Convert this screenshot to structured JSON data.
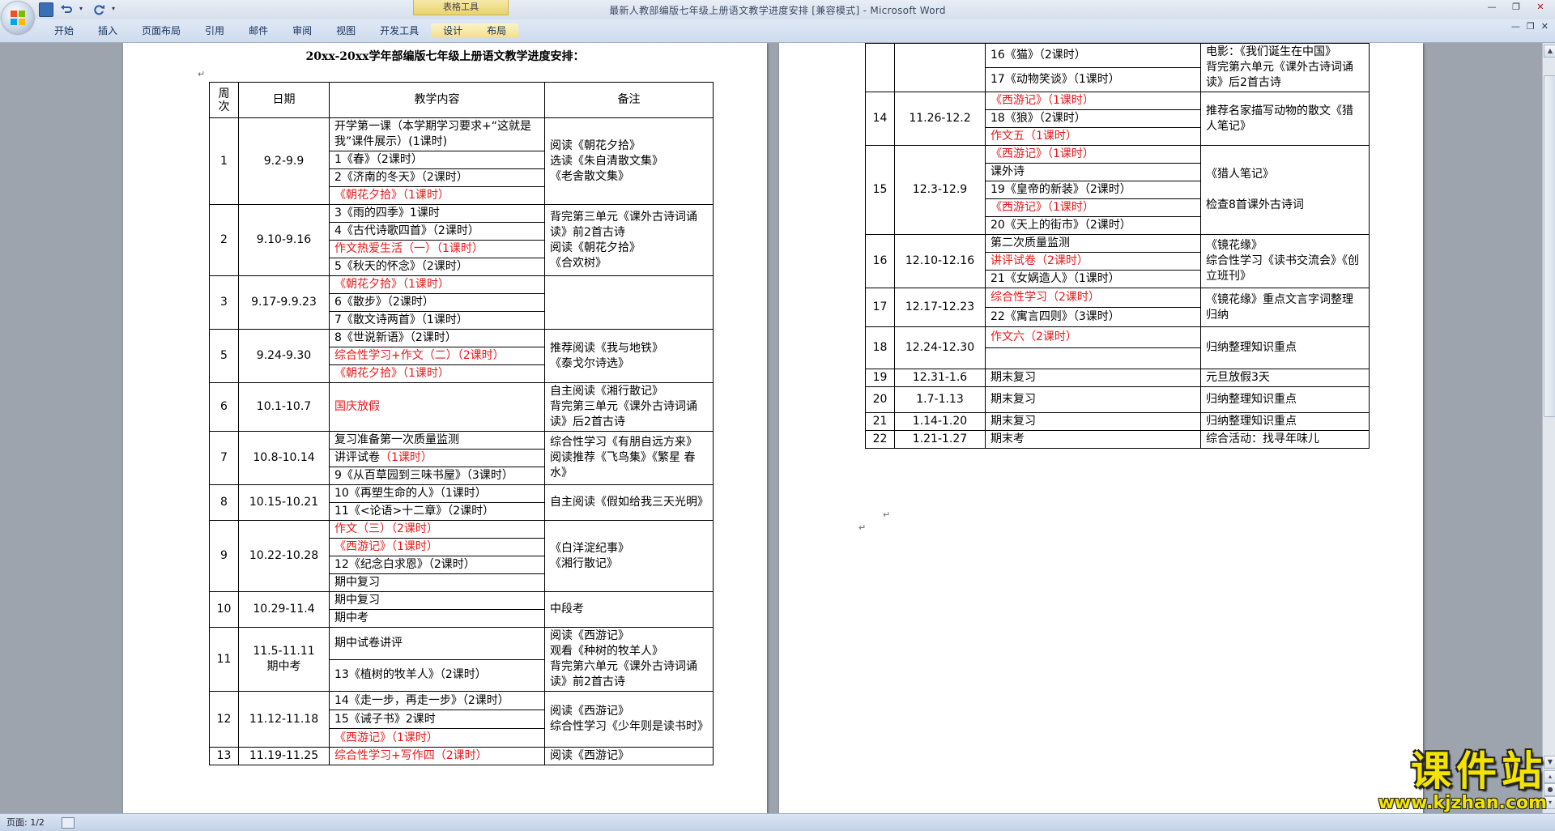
{
  "window": {
    "title": "最新人教部编版七年级上册语文教学进度安排 [兼容模式] - Microsoft Word",
    "context_tab_group": "表格工具"
  },
  "ribbon_tabs": [
    "开始",
    "插入",
    "页面布局",
    "引用",
    "邮件",
    "审阅",
    "视图",
    "开发工具",
    "设计",
    "布局"
  ],
  "status": {
    "page": "页面: 1/2"
  },
  "doc": {
    "title": "20xx-20xx学年部编版七年级上册语文教学进度安排：",
    "headers": {
      "week": "周次",
      "date": "日期",
      "content": "教学内容",
      "note": "备注"
    }
  },
  "rows_p1": [
    {
      "week": "1",
      "date": "9.2-9.9",
      "items": [
        {
          "t": "开学第一课（本学期学习要求+“这就是我”课件展示）(1课时)",
          "red": false
        },
        {
          "t": "1《春》（2课时）",
          "red": false
        },
        {
          "t": "2《济南的冬天》（2课时）",
          "red": false
        },
        {
          "t": "《朝花夕拾》（1课时）",
          "red": true
        }
      ],
      "note": "阅读《朝花夕拾》\n选读《朱自清散文集》\n《老舍散文集》"
    },
    {
      "week": "2",
      "date": "9.10-9.16",
      "items": [
        {
          "t": "3《雨的四季》1课时",
          "red": false
        },
        {
          "t": "4《古代诗歌四首》（2课时）",
          "red": false
        },
        {
          "t": "作文热爱生活（一）（1课时）",
          "red": true
        },
        {
          "t": "5《秋天的怀念》（2课时）",
          "red": false
        }
      ],
      "note": "背完第三单元《课外古诗词诵读》前2首古诗\n阅读《朝花夕拾》\n《合欢树》"
    },
    {
      "week": "3",
      "date": "9.17-9.9.23",
      "items": [
        {
          "t": "《朝花夕拾》（1课时）",
          "red": true
        },
        {
          "t": "6《散步》（2课时）",
          "red": false
        },
        {
          "t": "7《散文诗两首》（1课时）",
          "red": false
        }
      ],
      "note": ""
    },
    {
      "week": "5",
      "date": "9.24-9.30",
      "items": [
        {
          "t": "8《世说新语》（2课时）",
          "red": false
        },
        {
          "t": "综合性学习+作文（二）（2课时）",
          "red": true
        },
        {
          "t": "《朝花夕拾》（1课时）",
          "red": true
        }
      ],
      "note": "推荐阅读《我与地铁》\n《泰戈尔诗选》"
    },
    {
      "week": "6",
      "date": "10.1-10.7",
      "items": [
        {
          "t": "国庆放假",
          "red": true
        }
      ],
      "note": "自主阅读《湘行散记》\n背完第三单元《课外古诗词诵读》后2首古诗"
    },
    {
      "week": "7",
      "date": "10.8-10.14",
      "items": [
        {
          "t": "复习准备第一次质量监测",
          "red": false
        },
        {
          "t": "讲评试卷",
          "red": false,
          "suffix": "（1课时）"
        },
        {
          "t": "9《从百草园到三味书屋》（3课时）",
          "red": false
        }
      ],
      "note": "综合性学习《有朋自远方来》阅读推荐《飞鸟集》《繁星 春水》"
    },
    {
      "week": "8",
      "date": "10.15-10.21",
      "items": [
        {
          "t": "10《再塑生命的人》（1课时）",
          "red": false
        },
        {
          "t": "11《<论语>十二章》（2课时）",
          "red": false
        }
      ],
      "note": "自主阅读《假如给我三天光明》"
    },
    {
      "week": "9",
      "date": "10.22-10.28",
      "items": [
        {
          "t": "作文（三）（2课时）",
          "red": true
        },
        {
          "t": "《西游记》（1课时）",
          "red": true
        },
        {
          "t": "12《纪念白求恩》（2课时）",
          "red": false
        },
        {
          "t": "期中复习",
          "red": false
        }
      ],
      "note": "《白洋淀纪事》\n《湘行散记》"
    },
    {
      "week": "10",
      "date": "10.29-11.4",
      "items": [
        {
          "t": "期中复习",
          "red": false
        },
        {
          "t": "期中考",
          "red": false
        }
      ],
      "note": "中段考"
    },
    {
      "week": "11",
      "date": "11.5-11.11\n期中考",
      "items": [
        {
          "t": "期中试卷讲评",
          "red": false
        },
        {
          "t": "13《植树的牧羊人》（2课时）",
          "red": false
        }
      ],
      "note": "阅读《西游记》\n观看《种树的牧羊人》\n背完第六单元《课外古诗词诵读》前2首古诗"
    },
    {
      "week": "12",
      "date": "11.12-11.18",
      "items": [
        {
          "t": "14《走一步，再走一步》（2课时）",
          "red": false
        },
        {
          "t": "15《诫子书》2课时",
          "red": false
        },
        {
          "t": "《西游记》（1课时）",
          "red": true
        }
      ],
      "note": "阅读《西游记》\n综合性学习《少年则是读书时》"
    },
    {
      "week": "13",
      "date": "11.19-11.25",
      "items": [
        {
          "t": "综合性学习+写作四（2课时）",
          "red": true
        }
      ],
      "note": "阅读《西游记》"
    }
  ],
  "rows_p2": [
    {
      "week": "",
      "date": "",
      "items": [
        {
          "t": "16《猫》（2课时）",
          "red": false
        },
        {
          "t": "17《动物笑谈》（1课时）",
          "red": false
        }
      ],
      "note": "电影：《我们诞生在中国》\n背完第六单元《课外古诗词诵读》后2首古诗"
    },
    {
      "week": "14",
      "date": "11.26-12.2",
      "items": [
        {
          "t": "《西游记》（1课时）",
          "red": true
        },
        {
          "t": "18《狼》（2课时）",
          "red": false
        },
        {
          "t": "作文五（1课时）",
          "red": true
        }
      ],
      "note": "推荐名家描写动物的散文《猎人笔记》"
    },
    {
      "week": "15",
      "date": "12.3-12.9",
      "items": [
        {
          "t": "《西游记》（1课时）",
          "red": true
        },
        {
          "t": "课外诗",
          "red": false
        },
        {
          "t": "19《皇帝的新装》（2课时）",
          "red": false
        },
        {
          "t": "《西游记》（1课时）",
          "red": true
        },
        {
          "t": "20《天上的街市》（2课时）",
          "red": false
        }
      ],
      "note": "《猎人笔记》\n\n检查8首课外古诗词"
    },
    {
      "week": "16",
      "date": "12.10-12.16",
      "items": [
        {
          "t": "第二次质量监测",
          "red": false
        },
        {
          "t": "讲评试卷（2课时）",
          "red": true
        },
        {
          "t": "21《女娲造人》（1课时）",
          "red": false
        }
      ],
      "note": "《镜花缘》\n综合性学习《读书交流会》《创立班刊》"
    },
    {
      "week": "17",
      "date": "12.17-12.23",
      "items": [
        {
          "t": "综合性学习（2课时）",
          "red": true
        },
        {
          "t": "22《寓言四则》（3课时）",
          "red": false
        }
      ],
      "note": "《镜花缘》重点文言字词整理归纳"
    },
    {
      "week": "18",
      "date": "12.24-12.30",
      "items": [
        {
          "t": "作文六（2课时）",
          "red": true
        },
        {
          "t": "",
          "red": false
        }
      ],
      "note": "归纳整理知识重点"
    },
    {
      "week": "19",
      "date": "12.31-1.6",
      "items": [
        {
          "t": "期末复习",
          "red": false
        }
      ],
      "note": "元旦放假3天"
    },
    {
      "week": "20",
      "date": "1.7-1.13",
      "items": [
        {
          "t": "期末复习",
          "red": false
        }
      ],
      "note": "归纳整理知识重点"
    },
    {
      "week": "21",
      "date": "1.14-1.20",
      "items": [
        {
          "t": "期末复习",
          "red": false
        }
      ],
      "note": "归纳整理知识重点"
    },
    {
      "week": "22",
      "date": "1.21-1.27",
      "items": [
        {
          "t": "期末考",
          "red": false
        }
      ],
      "note": "综合活动：找寻年味儿"
    }
  ],
  "watermark": {
    "line1": "课件站",
    "line2": "www.kjzhan.com"
  },
  "colors": {
    "red_text": "#e8181a",
    "ribbon": "#cfdcee",
    "background": "#9da4ad"
  }
}
